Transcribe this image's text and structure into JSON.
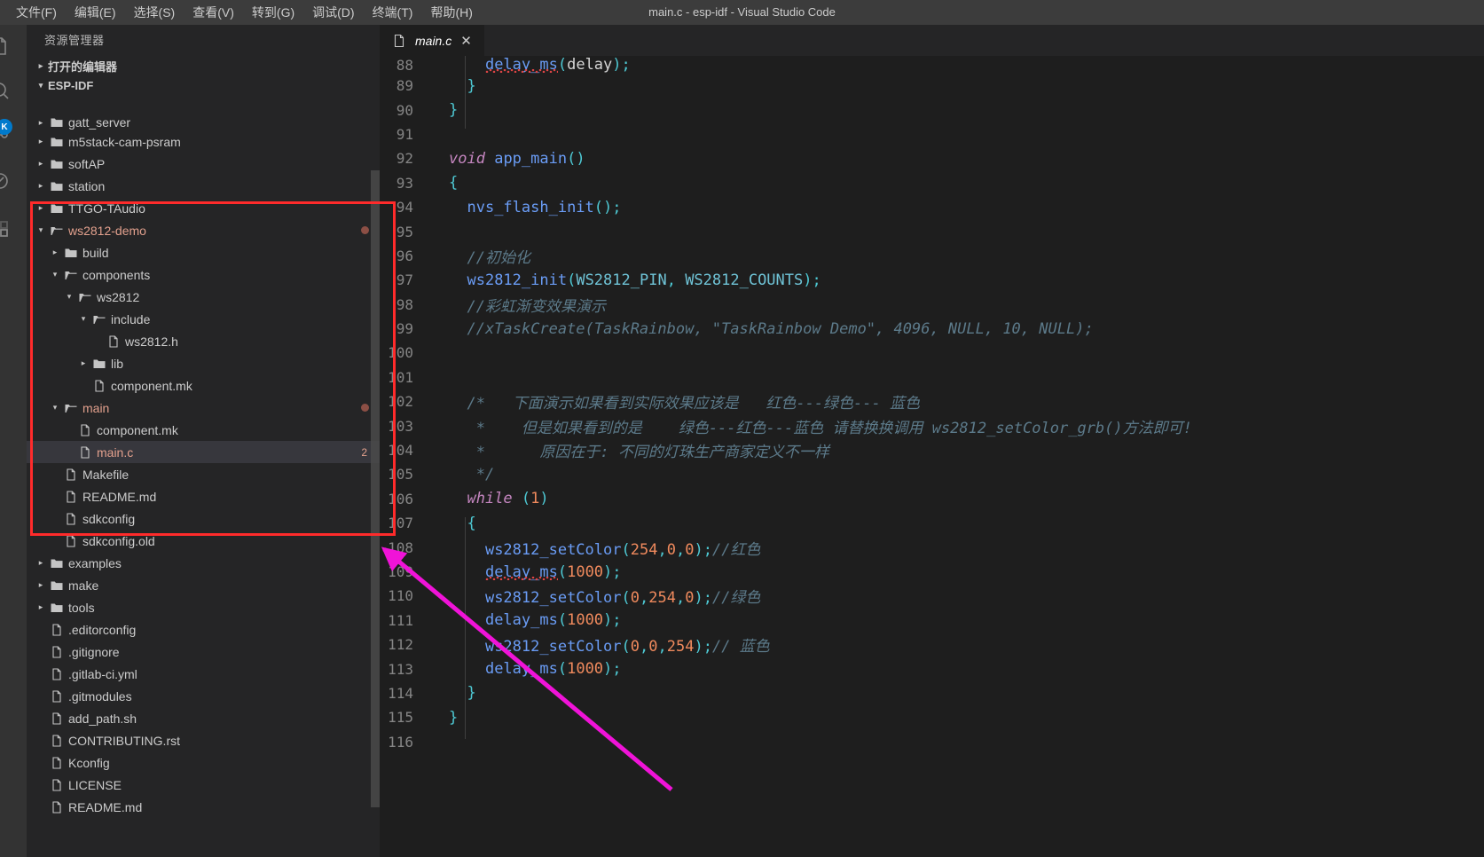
{
  "window": {
    "title": "main.c - esp-idf - Visual Studio Code"
  },
  "menubar": {
    "items": [
      {
        "label": "文件(F)",
        "name": "menu-file"
      },
      {
        "label": "编辑(E)",
        "name": "menu-edit"
      },
      {
        "label": "选择(S)",
        "name": "menu-selection"
      },
      {
        "label": "查看(V)",
        "name": "menu-view"
      },
      {
        "label": "转到(G)",
        "name": "menu-goto"
      },
      {
        "label": "调试(D)",
        "name": "menu-debug"
      },
      {
        "label": "终端(T)",
        "name": "menu-terminal"
      },
      {
        "label": "帮助(H)",
        "name": "menu-help"
      }
    ]
  },
  "activity_bar": {
    "badge": "K",
    "icons": [
      "files-icon",
      "search-icon",
      "source-control-icon",
      "debug-icon",
      "extensions-icon"
    ]
  },
  "sidebar": {
    "title": "资源管理器",
    "sections": [
      {
        "label": "打开的编辑器",
        "expanded": false
      },
      {
        "label": "ESP-IDF",
        "expanded": true
      }
    ],
    "tree": [
      {
        "label": "gatt_server",
        "type": "folder",
        "depth": 1,
        "state": "collapsed",
        "clipped": true
      },
      {
        "label": "m5stack-cam-psram",
        "type": "folder",
        "depth": 1,
        "state": "collapsed"
      },
      {
        "label": "softAP",
        "type": "folder",
        "depth": 1,
        "state": "collapsed"
      },
      {
        "label": "station",
        "type": "folder",
        "depth": 1,
        "state": "collapsed"
      },
      {
        "label": "TTGO-TAudio",
        "type": "folder",
        "depth": 1,
        "state": "collapsed"
      },
      {
        "label": "ws2812-demo",
        "type": "folder",
        "depth": 1,
        "state": "expanded",
        "modified": true,
        "dot": true
      },
      {
        "label": "build",
        "type": "folder",
        "depth": 2,
        "state": "collapsed"
      },
      {
        "label": "components",
        "type": "folder",
        "depth": 2,
        "state": "expanded"
      },
      {
        "label": "ws2812",
        "type": "folder",
        "depth": 3,
        "state": "expanded"
      },
      {
        "label": "include",
        "type": "folder",
        "depth": 4,
        "state": "expanded"
      },
      {
        "label": "ws2812.h",
        "type": "file",
        "depth": 5
      },
      {
        "label": "lib",
        "type": "folder",
        "depth": 4,
        "state": "collapsed"
      },
      {
        "label": "component.mk",
        "type": "file",
        "depth": 4
      },
      {
        "label": "main",
        "type": "folder",
        "depth": 2,
        "state": "expanded",
        "modified": true,
        "dot": true
      },
      {
        "label": "component.mk",
        "type": "file",
        "depth": 3
      },
      {
        "label": "main.c",
        "type": "file",
        "depth": 3,
        "modified": true,
        "selected": true,
        "badge": "2"
      },
      {
        "label": "Makefile",
        "type": "file",
        "depth": 2
      },
      {
        "label": "README.md",
        "type": "file",
        "depth": 2
      },
      {
        "label": "sdkconfig",
        "type": "file",
        "depth": 2
      },
      {
        "label": "sdkconfig.old",
        "type": "file",
        "depth": 2
      },
      {
        "label": "examples",
        "type": "folder",
        "depth": 1,
        "state": "collapsed"
      },
      {
        "label": "make",
        "type": "folder",
        "depth": 1,
        "state": "collapsed"
      },
      {
        "label": "tools",
        "type": "folder",
        "depth": 1,
        "state": "collapsed"
      },
      {
        "label": ".editorconfig",
        "type": "file",
        "depth": 1
      },
      {
        "label": ".gitignore",
        "type": "file",
        "depth": 1
      },
      {
        "label": ".gitlab-ci.yml",
        "type": "file",
        "depth": 1
      },
      {
        "label": ".gitmodules",
        "type": "file",
        "depth": 1
      },
      {
        "label": "add_path.sh",
        "type": "file",
        "depth": 1
      },
      {
        "label": "CONTRIBUTING.rst",
        "type": "file",
        "depth": 1
      },
      {
        "label": "Kconfig",
        "type": "file",
        "depth": 1
      },
      {
        "label": "LICENSE",
        "type": "file",
        "depth": 1
      },
      {
        "label": "README.md",
        "type": "file",
        "depth": 1
      }
    ]
  },
  "editor": {
    "tab": {
      "label": "main.c",
      "icon": "c-file-icon",
      "close_label": "✕",
      "preview": true
    },
    "first_line": 88,
    "lines": [
      {
        "n": 88,
        "clipped": true,
        "tokens": [
          {
            "t": "    ",
            "c": "t-plain"
          },
          {
            "t": "delay_ms",
            "c": "t-call",
            "squiggle": true
          },
          {
            "t": "(",
            "c": "t-punct"
          },
          {
            "t": "delay",
            "c": "t-plain"
          },
          {
            "t": ")",
            "c": "t-punct"
          },
          {
            "t": ";",
            "c": "t-punct"
          }
        ]
      },
      {
        "n": 89,
        "tokens": [
          {
            "t": "  ",
            "c": "t-plain"
          },
          {
            "t": "}",
            "c": "t-brace"
          }
        ]
      },
      {
        "n": 90,
        "tokens": [
          {
            "t": "}",
            "c": "t-brace"
          }
        ]
      },
      {
        "n": 91,
        "tokens": []
      },
      {
        "n": 92,
        "tokens": [
          {
            "t": "void",
            "c": "t-key"
          },
          {
            "t": " ",
            "c": "t-plain"
          },
          {
            "t": "app_main",
            "c": "t-fn"
          },
          {
            "t": "()",
            "c": "t-punct"
          }
        ]
      },
      {
        "n": 93,
        "tokens": [
          {
            "t": "{",
            "c": "t-brace"
          }
        ]
      },
      {
        "n": 94,
        "tokens": [
          {
            "t": "  ",
            "c": "t-plain"
          },
          {
            "t": "nvs_flash_init",
            "c": "t-call"
          },
          {
            "t": "()",
            "c": "t-punct"
          },
          {
            "t": ";",
            "c": "t-punct"
          }
        ]
      },
      {
        "n": 95,
        "tokens": []
      },
      {
        "n": 96,
        "tokens": [
          {
            "t": "  //初始化",
            "c": "t-cmt"
          }
        ]
      },
      {
        "n": 97,
        "tokens": [
          {
            "t": "  ",
            "c": "t-plain"
          },
          {
            "t": "ws2812_init",
            "c": "t-call"
          },
          {
            "t": "(",
            "c": "t-punct"
          },
          {
            "t": "WS2812_PIN",
            "c": "t-const"
          },
          {
            "t": ",",
            "c": "t-punct"
          },
          {
            "t": " ",
            "c": "t-plain"
          },
          {
            "t": "WS2812_COUNTS",
            "c": "t-const"
          },
          {
            "t": ")",
            "c": "t-punct"
          },
          {
            "t": ";",
            "c": "t-punct"
          }
        ]
      },
      {
        "n": 98,
        "tokens": [
          {
            "t": "  //彩虹渐变效果演示",
            "c": "t-cmt"
          }
        ]
      },
      {
        "n": 99,
        "tokens": [
          {
            "t": "  //xTaskCreate(TaskRainbow, \"TaskRainbow Demo\", 4096, NULL, 10, NULL);",
            "c": "t-cmt"
          }
        ]
      },
      {
        "n": 100,
        "tokens": []
      },
      {
        "n": 101,
        "tokens": []
      },
      {
        "n": 102,
        "tokens": [
          {
            "t": "  /*   下面演示如果看到实际效果应该是   红色---绿色--- 蓝色",
            "c": "t-cmt"
          }
        ]
      },
      {
        "n": 103,
        "tokens": [
          {
            "t": "   *    但是如果看到的是    绿色---红色---蓝色 请替换换调用 ws2812_setColor_grb()方法即可!",
            "c": "t-cmt"
          }
        ]
      },
      {
        "n": 104,
        "tokens": [
          {
            "t": "   *      原因在于: 不同的灯珠生产商家定义不一样",
            "c": "t-cmt"
          }
        ]
      },
      {
        "n": 105,
        "tokens": [
          {
            "t": "   */",
            "c": "t-cmt"
          }
        ]
      },
      {
        "n": 106,
        "tokens": [
          {
            "t": "  ",
            "c": "t-plain"
          },
          {
            "t": "while",
            "c": "t-key"
          },
          {
            "t": " ",
            "c": "t-plain"
          },
          {
            "t": "(",
            "c": "t-punct"
          },
          {
            "t": "1",
            "c": "t-num"
          },
          {
            "t": ")",
            "c": "t-punct"
          }
        ]
      },
      {
        "n": 107,
        "tokens": [
          {
            "t": "  ",
            "c": "t-plain"
          },
          {
            "t": "{",
            "c": "t-brace"
          }
        ]
      },
      {
        "n": 108,
        "tokens": [
          {
            "t": "    ",
            "c": "t-plain"
          },
          {
            "t": "ws2812_setColor",
            "c": "t-call"
          },
          {
            "t": "(",
            "c": "t-punct"
          },
          {
            "t": "254",
            "c": "t-num"
          },
          {
            "t": ",",
            "c": "t-punct"
          },
          {
            "t": "0",
            "c": "t-num"
          },
          {
            "t": ",",
            "c": "t-punct"
          },
          {
            "t": "0",
            "c": "t-num"
          },
          {
            "t": ")",
            "c": "t-punct"
          },
          {
            "t": ";",
            "c": "t-punct"
          },
          {
            "t": "//红色",
            "c": "t-cmt"
          }
        ]
      },
      {
        "n": 109,
        "tokens": [
          {
            "t": "    ",
            "c": "t-plain"
          },
          {
            "t": "delay_ms",
            "c": "t-call",
            "squiggle": true
          },
          {
            "t": "(",
            "c": "t-punct"
          },
          {
            "t": "1000",
            "c": "t-num"
          },
          {
            "t": ")",
            "c": "t-punct"
          },
          {
            "t": ";",
            "c": "t-punct"
          }
        ]
      },
      {
        "n": 110,
        "tokens": [
          {
            "t": "    ",
            "c": "t-plain"
          },
          {
            "t": "ws2812_setColor",
            "c": "t-call"
          },
          {
            "t": "(",
            "c": "t-punct"
          },
          {
            "t": "0",
            "c": "t-num"
          },
          {
            "t": ",",
            "c": "t-punct"
          },
          {
            "t": "254",
            "c": "t-num"
          },
          {
            "t": ",",
            "c": "t-punct"
          },
          {
            "t": "0",
            "c": "t-num"
          },
          {
            "t": ")",
            "c": "t-punct"
          },
          {
            "t": ";",
            "c": "t-punct"
          },
          {
            "t": "//绿色",
            "c": "t-cmt"
          }
        ]
      },
      {
        "n": 111,
        "tokens": [
          {
            "t": "    ",
            "c": "t-plain"
          },
          {
            "t": "delay_ms",
            "c": "t-call"
          },
          {
            "t": "(",
            "c": "t-punct"
          },
          {
            "t": "1000",
            "c": "t-num"
          },
          {
            "t": ")",
            "c": "t-punct"
          },
          {
            "t": ";",
            "c": "t-punct"
          }
        ]
      },
      {
        "n": 112,
        "tokens": [
          {
            "t": "    ",
            "c": "t-plain"
          },
          {
            "t": "ws2812_setColor",
            "c": "t-call"
          },
          {
            "t": "(",
            "c": "t-punct"
          },
          {
            "t": "0",
            "c": "t-num"
          },
          {
            "t": ",",
            "c": "t-punct"
          },
          {
            "t": "0",
            "c": "t-num"
          },
          {
            "t": ",",
            "c": "t-punct"
          },
          {
            "t": "254",
            "c": "t-num"
          },
          {
            "t": ")",
            "c": "t-punct"
          },
          {
            "t": ";",
            "c": "t-punct"
          },
          {
            "t": "// 蓝色",
            "c": "t-cmt"
          }
        ]
      },
      {
        "n": 113,
        "tokens": [
          {
            "t": "    ",
            "c": "t-plain"
          },
          {
            "t": "delay_ms",
            "c": "t-call"
          },
          {
            "t": "(",
            "c": "t-punct"
          },
          {
            "t": "1000",
            "c": "t-num"
          },
          {
            "t": ")",
            "c": "t-punct"
          },
          {
            "t": ";",
            "c": "t-punct"
          }
        ]
      },
      {
        "n": 114,
        "tokens": [
          {
            "t": "  ",
            "c": "t-plain"
          },
          {
            "t": "}",
            "c": "t-brace"
          }
        ]
      },
      {
        "n": 115,
        "tokens": [
          {
            "t": "}",
            "c": "t-brace"
          }
        ]
      },
      {
        "n": 116,
        "tokens": []
      }
    ]
  },
  "annotations": {
    "red_box_color": "#ff2b2b",
    "arrow_color": "#f013d8"
  }
}
